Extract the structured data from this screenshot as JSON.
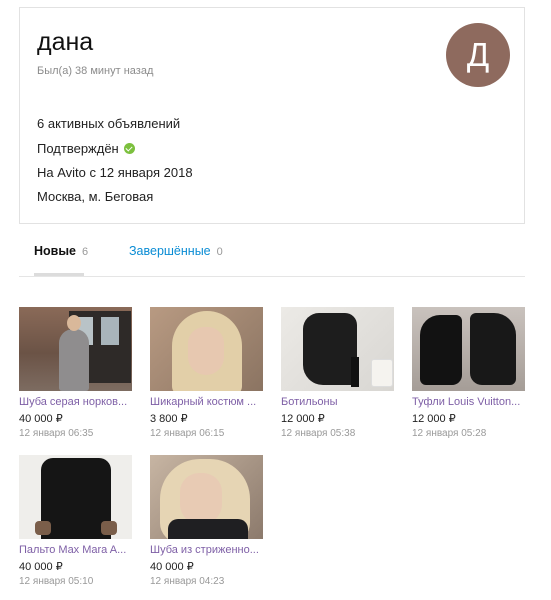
{
  "profile": {
    "name": "дана",
    "last_seen": "Был(а) 38 минут назад",
    "avatar_letter": "Д",
    "avatar_color": "#8e6a5e",
    "active_ads": "6 активных объявлений",
    "verified": "Подтверждён",
    "since": "На Avito с 12 января 2018",
    "location": "Москва, м. Беговая"
  },
  "tabs": [
    {
      "label": "Новые",
      "count": "6",
      "active": true
    },
    {
      "label": "Завершённые",
      "count": "0",
      "active": false
    }
  ],
  "listings": [
    {
      "title": "Шуба серая норков...",
      "price": "40 000 ₽",
      "date": "12 января 06:35",
      "image": "fur-coat-photo"
    },
    {
      "title": "Шикарный костюм ...",
      "price": "3 800 ₽",
      "date": "12 января 06:15",
      "image": "woman-portrait-photo"
    },
    {
      "title": "Ботильоны",
      "price": "12 000 ₽",
      "date": "12 января 05:38",
      "image": "ankle-boots-photo"
    },
    {
      "title": "Туфли Louis Vuitton...",
      "price": "12 000 ₽",
      "date": "12 января 05:28",
      "image": "heels-photo"
    },
    {
      "title": "Пальто Max Mara A...",
      "price": "40 000 ₽",
      "date": "12 января 05:10",
      "image": "black-coat-photo"
    },
    {
      "title": "Шуба из стриженно...",
      "price": "40 000 ₽",
      "date": "12 января 04:23",
      "image": "woman-selfie-photo"
    }
  ],
  "colors": {
    "link_blue": "#0a8cd4",
    "listing_title": "#7e5fa6",
    "verified_green": "#7cc03e"
  }
}
